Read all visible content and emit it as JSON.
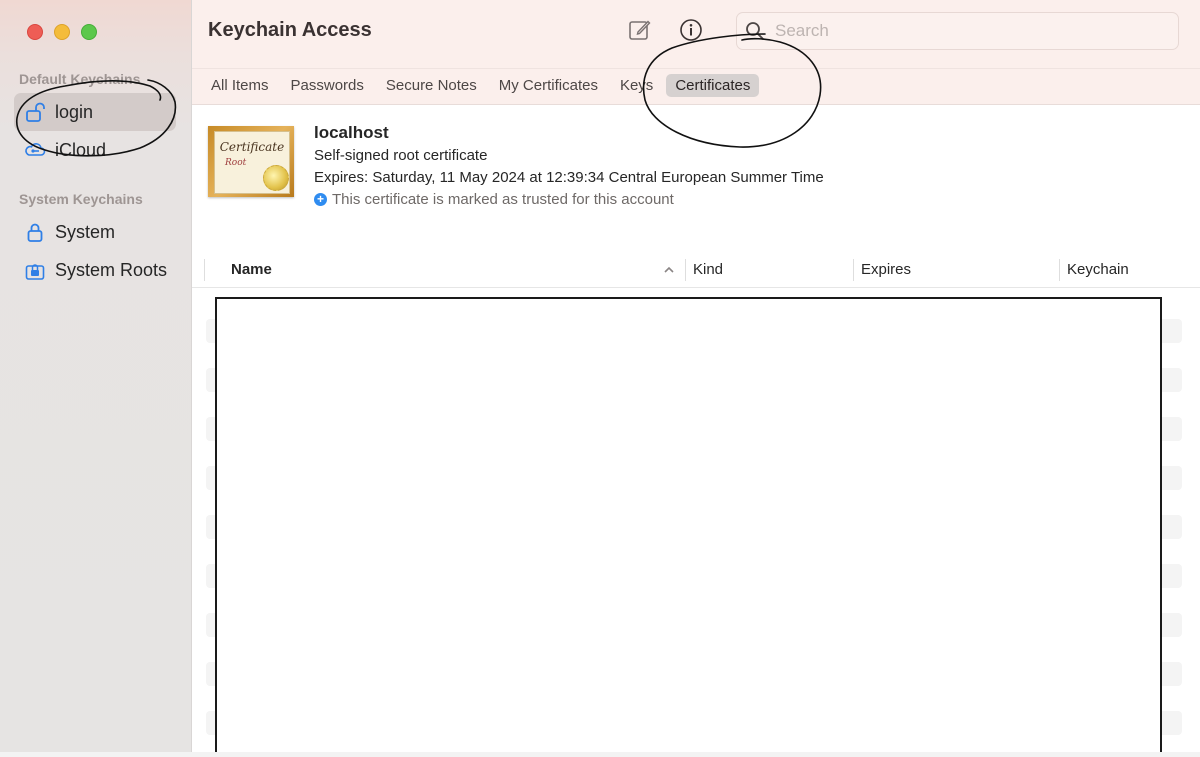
{
  "app": {
    "title": "Keychain Access"
  },
  "sidebar": {
    "sections": [
      {
        "title": "Default Keychains",
        "items": [
          {
            "label": "login",
            "icon": "unlocked-padlock-icon",
            "selected": true
          },
          {
            "label": "iCloud",
            "icon": "icloud-key-icon",
            "selected": false
          }
        ]
      },
      {
        "title": "System Keychains",
        "items": [
          {
            "label": "System",
            "icon": "padlock-icon",
            "selected": false
          },
          {
            "label": "System Roots",
            "icon": "locked-cabinet-icon",
            "selected": false
          }
        ]
      }
    ]
  },
  "toolbar": {
    "compose_icon": "compose-icon",
    "info_icon": "info-icon",
    "search": {
      "placeholder": "Search",
      "value": ""
    }
  },
  "tabs": [
    {
      "label": "All Items",
      "active": false
    },
    {
      "label": "Passwords",
      "active": false
    },
    {
      "label": "Secure Notes",
      "active": false
    },
    {
      "label": "My Certificates",
      "active": false
    },
    {
      "label": "Keys",
      "active": false
    },
    {
      "label": "Certificates",
      "active": true
    }
  ],
  "certificate": {
    "image_text": "Certificate",
    "image_subtext": "Root",
    "name": "localhost",
    "type": "Self-signed root certificate",
    "expires": "Expires: Saturday, 11 May 2024 at 12:39:34 Central European Summer Time",
    "trust": "This certificate is marked as trusted for this account"
  },
  "table": {
    "columns": [
      "Name",
      "Kind",
      "Expires",
      "Keychain"
    ],
    "sort": {
      "column": "Name",
      "direction": "ascending"
    }
  },
  "colors": {
    "accent": "#2f8cf0",
    "sidebar_selected": "#d3cbc9",
    "tab_active": "#d6d1d0",
    "annotation_ink": "#111111"
  }
}
